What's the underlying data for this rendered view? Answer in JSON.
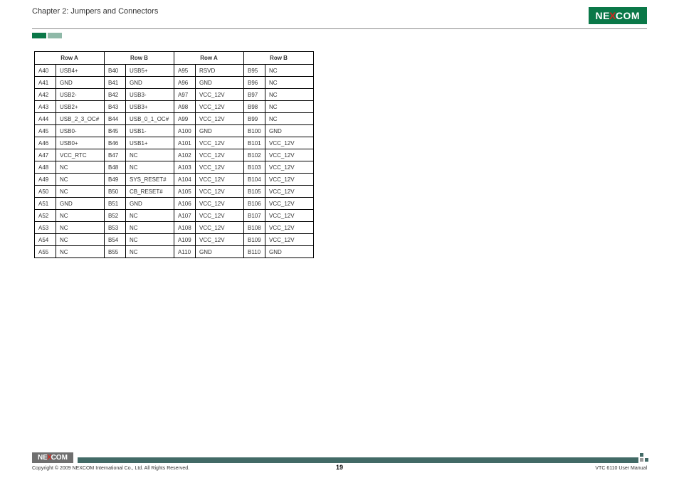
{
  "header": {
    "chapter": "Chapter 2: Jumpers and Connectors",
    "logo": {
      "pre": "NE",
      "x": "X",
      "post": "COM"
    }
  },
  "table": {
    "headers": [
      "Row A",
      "Row B",
      "Row A",
      "Row B"
    ],
    "rows": [
      {
        "a1": "A40",
        "v1": "USB4+",
        "a2": "B40",
        "v2": "USB5+",
        "a3": "A95",
        "v3": "RSVD",
        "a4": "B95",
        "v4": "NC"
      },
      {
        "a1": "A41",
        "v1": "GND",
        "a2": "B41",
        "v2": "GND",
        "a3": "A96",
        "v3": "GND",
        "a4": "B96",
        "v4": "NC"
      },
      {
        "a1": "A42",
        "v1": "USB2-",
        "a2": "B42",
        "v2": "USB3-",
        "a3": "A97",
        "v3": "VCC_12V",
        "a4": "B97",
        "v4": "NC"
      },
      {
        "a1": "A43",
        "v1": "USB2+",
        "a2": "B43",
        "v2": "USB3+",
        "a3": "A98",
        "v3": "VCC_12V",
        "a4": "B98",
        "v4": "NC"
      },
      {
        "a1": "A44",
        "v1": "USB_2_3_OC#",
        "a2": "B44",
        "v2": "USB_0_1_OC#",
        "a3": "A99",
        "v3": "VCC_12V",
        "a4": "B99",
        "v4": "NC"
      },
      {
        "a1": "A45",
        "v1": "USB0-",
        "a2": "B45",
        "v2": "USB1-",
        "a3": "A100",
        "v3": "GND",
        "a4": "B100",
        "v4": "GND"
      },
      {
        "a1": "A46",
        "v1": "USB0+",
        "a2": "B46",
        "v2": "USB1+",
        "a3": "A101",
        "v3": "VCC_12V",
        "a4": "B101",
        "v4": "VCC_12V"
      },
      {
        "a1": "A47",
        "v1": "VCC_RTC",
        "a2": "B47",
        "v2": "NC",
        "a3": "A102",
        "v3": "VCC_12V",
        "a4": "B102",
        "v4": "VCC_12V"
      },
      {
        "a1": "A48",
        "v1": "NC",
        "a2": "B48",
        "v2": "NC",
        "a3": "A103",
        "v3": "VCC_12V",
        "a4": "B103",
        "v4": "VCC_12V"
      },
      {
        "a1": "A49",
        "v1": "NC",
        "a2": "B49",
        "v2": "SYS_RESET#",
        "a3": "A104",
        "v3": "VCC_12V",
        "a4": "B104",
        "v4": "VCC_12V"
      },
      {
        "a1": "A50",
        "v1": "NC",
        "a2": "B50",
        "v2": "CB_RESET#",
        "a3": "A105",
        "v3": "VCC_12V",
        "a4": "B105",
        "v4": "VCC_12V"
      },
      {
        "a1": "A51",
        "v1": "GND",
        "a2": "B51",
        "v2": "GND",
        "a3": "A106",
        "v3": "VCC_12V",
        "a4": "B106",
        "v4": "VCC_12V"
      },
      {
        "a1": "A52",
        "v1": "NC",
        "a2": "B52",
        "v2": "NC",
        "a3": "A107",
        "v3": "VCC_12V",
        "a4": "B107",
        "v4": "VCC_12V"
      },
      {
        "a1": "A53",
        "v1": "NC",
        "a2": "B53",
        "v2": "NC",
        "a3": "A108",
        "v3": "VCC_12V",
        "a4": "B108",
        "v4": "VCC_12V"
      },
      {
        "a1": "A54",
        "v1": "NC",
        "a2": "B54",
        "v2": "NC",
        "a3": "A109",
        "v3": "VCC_12V",
        "a4": "B109",
        "v4": "VCC_12V"
      },
      {
        "a1": "A55",
        "v1": "NC",
        "a2": "B55",
        "v2": "NC",
        "a3": "A110",
        "v3": "GND",
        "a4": "B110",
        "v4": "GND"
      }
    ]
  },
  "footer": {
    "copyright": "Copyright © 2009 NEXCOM International Co., Ltd. All Rights Reserved.",
    "page": "19",
    "doc": "VTC 6110 User Manual",
    "logo": {
      "pre": "NE",
      "x": "X",
      "post": "COM"
    }
  }
}
